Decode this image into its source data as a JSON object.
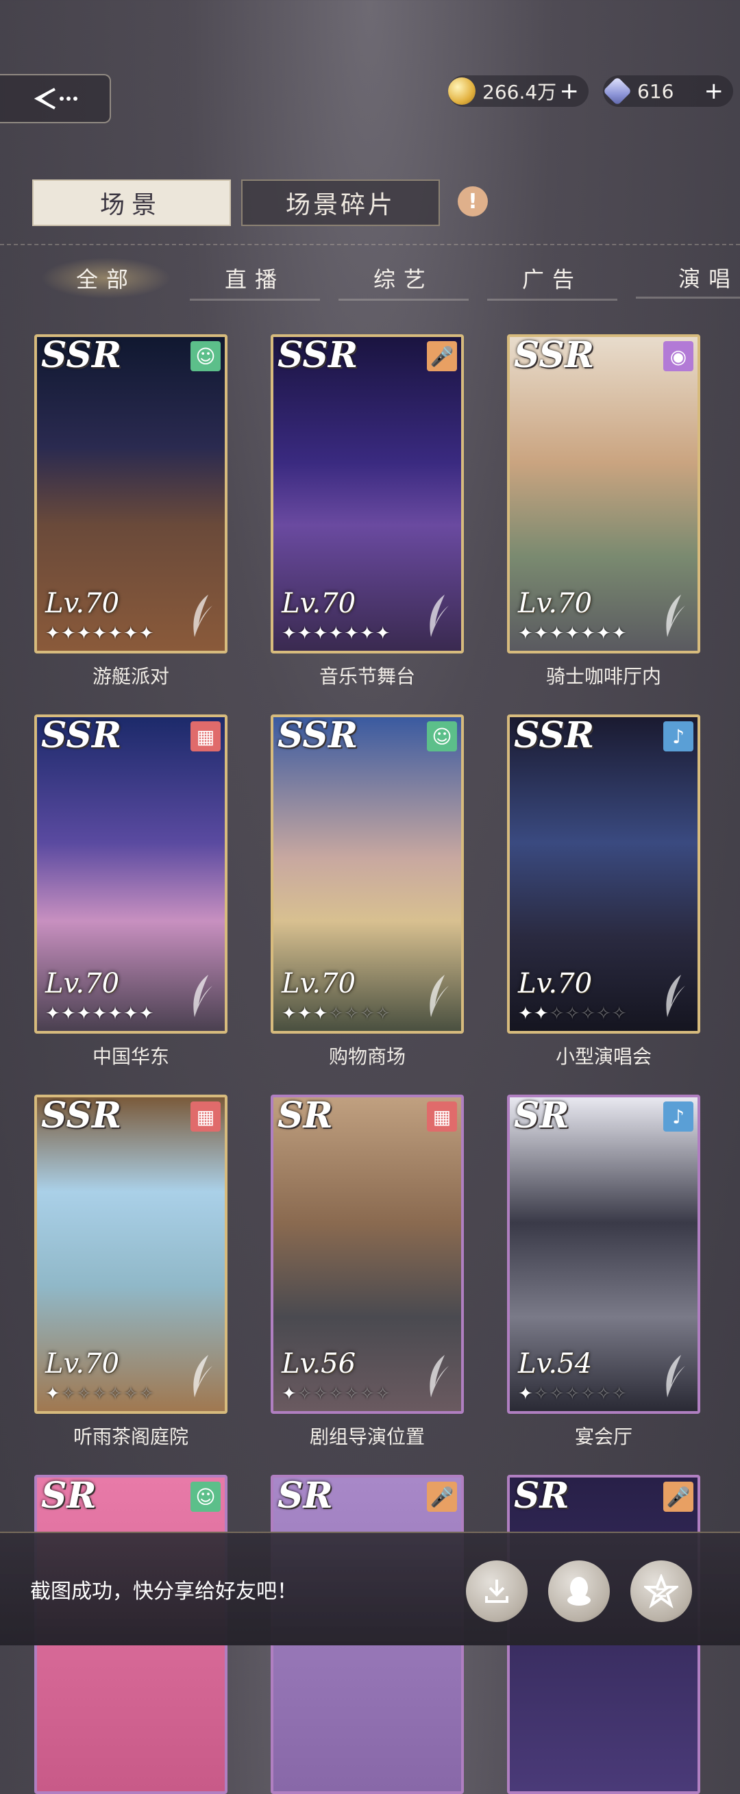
{
  "header": {
    "coins": "266.4万",
    "gems": "616"
  },
  "tabs": {
    "scene": "场景",
    "fragments": "场景碎片",
    "alert": "!"
  },
  "categories": [
    "全部",
    "直播",
    "综艺",
    "广告",
    "演唱"
  ],
  "cards": [
    {
      "rarity": "SSR",
      "level": "Lv.70",
      "stars": 7,
      "name": "游艇派对",
      "icon": "smile-icon",
      "icon_color": "#5cbf8a"
    },
    {
      "rarity": "SSR",
      "level": "Lv.70",
      "stars": 7,
      "name": "音乐节舞台",
      "icon": "microphone-icon",
      "icon_color": "#e8a063"
    },
    {
      "rarity": "SSR",
      "level": "Lv.70",
      "stars": 7,
      "name": "骑士咖啡厅内",
      "icon": "record-icon",
      "icon_color": "#b27ad6"
    },
    {
      "rarity": "SSR",
      "level": "Lv.70",
      "stars": 7,
      "name": "中国华东",
      "icon": "clapperboard-icon",
      "icon_color": "#e06b6b"
    },
    {
      "rarity": "SSR",
      "level": "Lv.70",
      "stars": 3,
      "name": "购物商场",
      "icon": "smile-icon",
      "icon_color": "#5cbf8a"
    },
    {
      "rarity": "SSR",
      "level": "Lv.70",
      "stars": 2,
      "name": "小型演唱会",
      "icon": "mic-stand-icon",
      "icon_color": "#5a9fd6"
    },
    {
      "rarity": "SSR",
      "level": "Lv.70",
      "stars": 1,
      "name": "听雨茶阁庭院",
      "icon": "clapperboard-icon",
      "icon_color": "#e06b6b"
    },
    {
      "rarity": "SR",
      "level": "Lv.56",
      "stars": 1,
      "name": "剧组导演位置",
      "icon": "clapperboard-icon",
      "icon_color": "#e06b6b"
    },
    {
      "rarity": "SR",
      "level": "Lv.54",
      "stars": 1,
      "name": "宴会厅",
      "icon": "mic-stand-icon",
      "icon_color": "#5a9fd6"
    },
    {
      "rarity": "SR",
      "level": "",
      "stars": 0,
      "name": "",
      "icon": "smile-icon",
      "icon_color": "#5cbf8a"
    },
    {
      "rarity": "SR",
      "level": "",
      "stars": 0,
      "name": "",
      "icon": "microphone-icon",
      "icon_color": "#e8a063"
    },
    {
      "rarity": "SR",
      "level": "",
      "stars": 0,
      "name": "",
      "icon": "microphone-icon",
      "icon_color": "#e8a063"
    }
  ],
  "toast": {
    "message": "截图成功，快分享给好友吧！"
  }
}
